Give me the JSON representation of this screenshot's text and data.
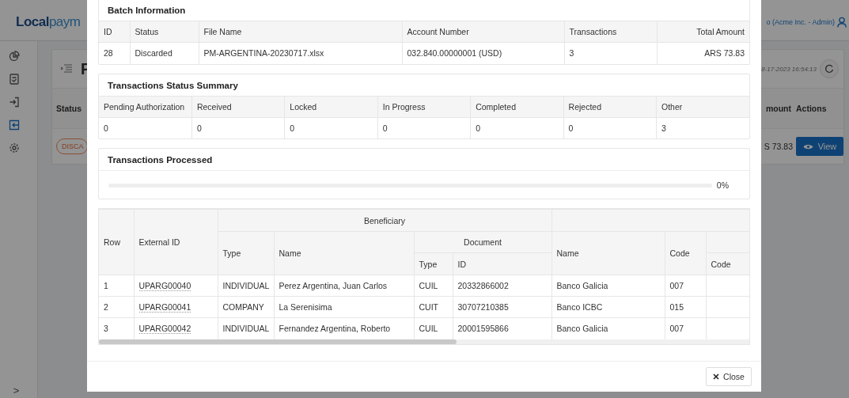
{
  "app": {
    "logo": {
      "part_1": "Local",
      "part_2": "paym"
    },
    "user": "o (Acme Inc. - Admin)",
    "sidebar": {
      "items": [
        {
          "selected": false
        },
        {
          "selected": false
        },
        {
          "selected": false
        },
        {
          "selected": true
        },
        {
          "selected": false
        }
      ],
      "toggle": ">"
    },
    "page": {
      "title": "F",
      "updated": "8-17-2023 16:54:13",
      "columns": [
        "Status",
        "mount",
        "Actions"
      ],
      "row": {
        "status": "DISCA",
        "amount": "S 73.83",
        "action": "View"
      }
    }
  },
  "modal": {
    "batch_information": {
      "title": "Batch Information",
      "columns": [
        "ID",
        "Status",
        "File Name",
        "Account Number",
        "Transactions",
        "Total Amount"
      ],
      "row": [
        "28",
        "Discarded",
        "PM-ARGENTINA-20230717.xlsx",
        "032.840.00000001 (USD)",
        "3",
        "ARS 73.83"
      ]
    },
    "status_summary": {
      "title": "Transactions Status Summary",
      "columns": [
        "Pending Authorization",
        "Received",
        "Locked",
        "In Progress",
        "Completed",
        "Rejected",
        "Other"
      ],
      "row": [
        "0",
        "0",
        "0",
        "0",
        "0",
        "0",
        "3"
      ]
    },
    "processed": {
      "title": "Transactions Processed",
      "level": 0,
      "reading": "0%"
    },
    "transactions": {
      "headers": {
        "row": "Row",
        "external_id": "External ID",
        "beneficiary": "Beneficiary",
        "type": "Type",
        "name": "Name",
        "document": "Document",
        "document_type": "Type",
        "document_id": "ID",
        "column_7": "Name",
        "column_8": "Code",
        "column_9": "Code"
      },
      "rows": [
        [
          "1",
          "UPARG00040",
          "INDIVIDUAL",
          "Perez Argentina, Juan Carlos",
          "CUIL",
          "20332866002",
          "Banco Galicia",
          "007"
        ],
        [
          "2",
          "UPARG00041",
          "COMPANY",
          "La Serenisima",
          "CUIT",
          "30707210385",
          "Banco ICBC",
          "015"
        ],
        [
          "3",
          "UPARG00042",
          "INDIVIDUAL",
          "Fernandez Argentina, Roberto",
          "CUIL",
          "20001595866",
          "Banco Galicia",
          "007"
        ]
      ]
    },
    "close": "Close"
  }
}
